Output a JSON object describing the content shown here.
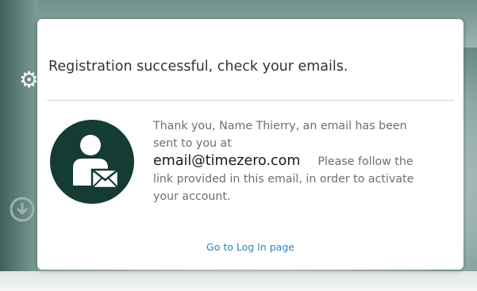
{
  "dialog": {
    "title": "Registration successful, check your emails.",
    "message_part1": "Thank you, Name Thierry, an email has been sent to you at",
    "email": "email@timezero.com",
    "message_part2": "Please follow the link provided in this email, in order to activate your account.",
    "login_link": "Go to Log In page"
  },
  "icons": {
    "avatar": "user-with-envelope-icon",
    "background_gear": "gear-icon",
    "background_download": "download-circle-icon"
  },
  "colors": {
    "avatar_fill": "#143b34",
    "link": "#2e86c1",
    "title_text": "#333333",
    "body_text": "#6e6e6e"
  }
}
